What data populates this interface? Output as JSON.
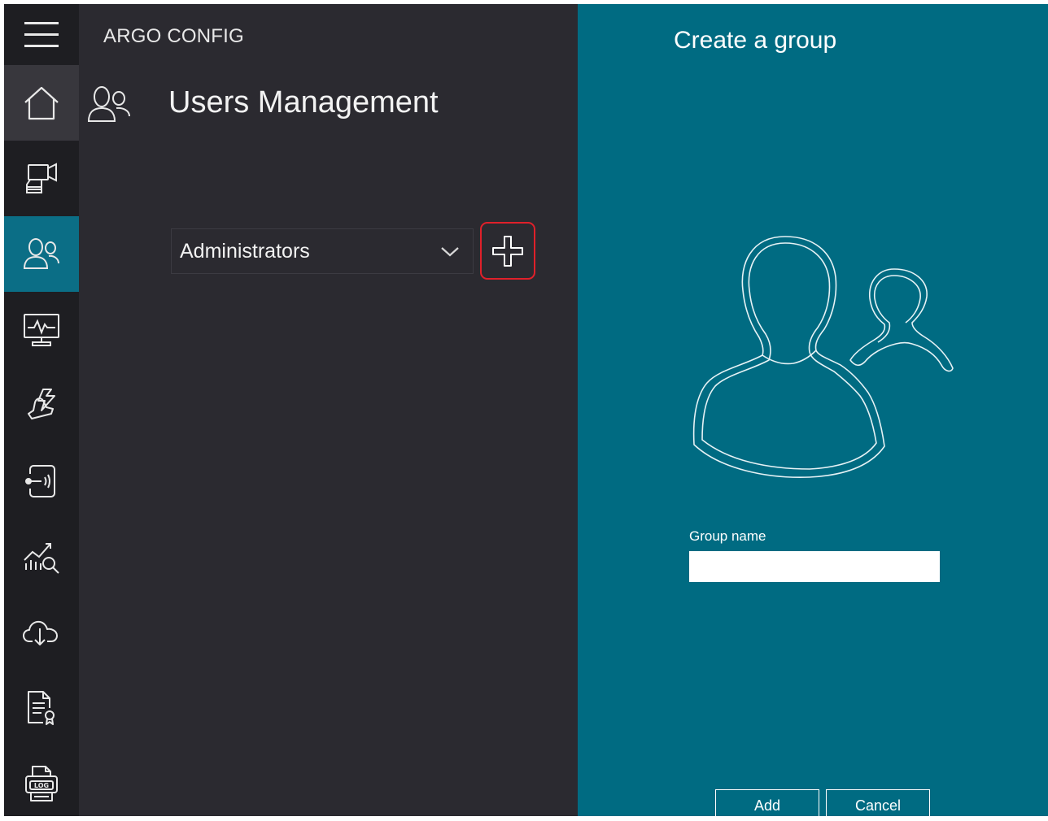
{
  "app": {
    "title": "ARGO CONFIG"
  },
  "page": {
    "title": "Users Management"
  },
  "sidebar": {
    "items": [
      {
        "name": "home",
        "icon": "home-icon"
      },
      {
        "name": "camera",
        "icon": "camera-device-icon"
      },
      {
        "name": "users",
        "icon": "users-icon",
        "active": true
      },
      {
        "name": "monitor",
        "icon": "monitor-pulse-icon"
      },
      {
        "name": "alarm",
        "icon": "alarm-bell-icon"
      },
      {
        "name": "access",
        "icon": "access-card-icon"
      },
      {
        "name": "analytics",
        "icon": "analytics-search-icon"
      },
      {
        "name": "cloud",
        "icon": "cloud-download-icon"
      },
      {
        "name": "license",
        "icon": "license-document-icon"
      },
      {
        "name": "log",
        "icon": "log-printer-icon"
      }
    ]
  },
  "group_selector": {
    "selected": "Administrators"
  },
  "create_panel": {
    "title": "Create a group",
    "field_label": "Group name",
    "field_value": "",
    "add_label": "Add",
    "cancel_label": "Cancel"
  },
  "colors": {
    "sidebar_bg": "#1e1e22",
    "main_bg": "#2b2a30",
    "accent": "#0b6e86",
    "panel_bg": "#006b82",
    "highlight": "#e0202a"
  }
}
